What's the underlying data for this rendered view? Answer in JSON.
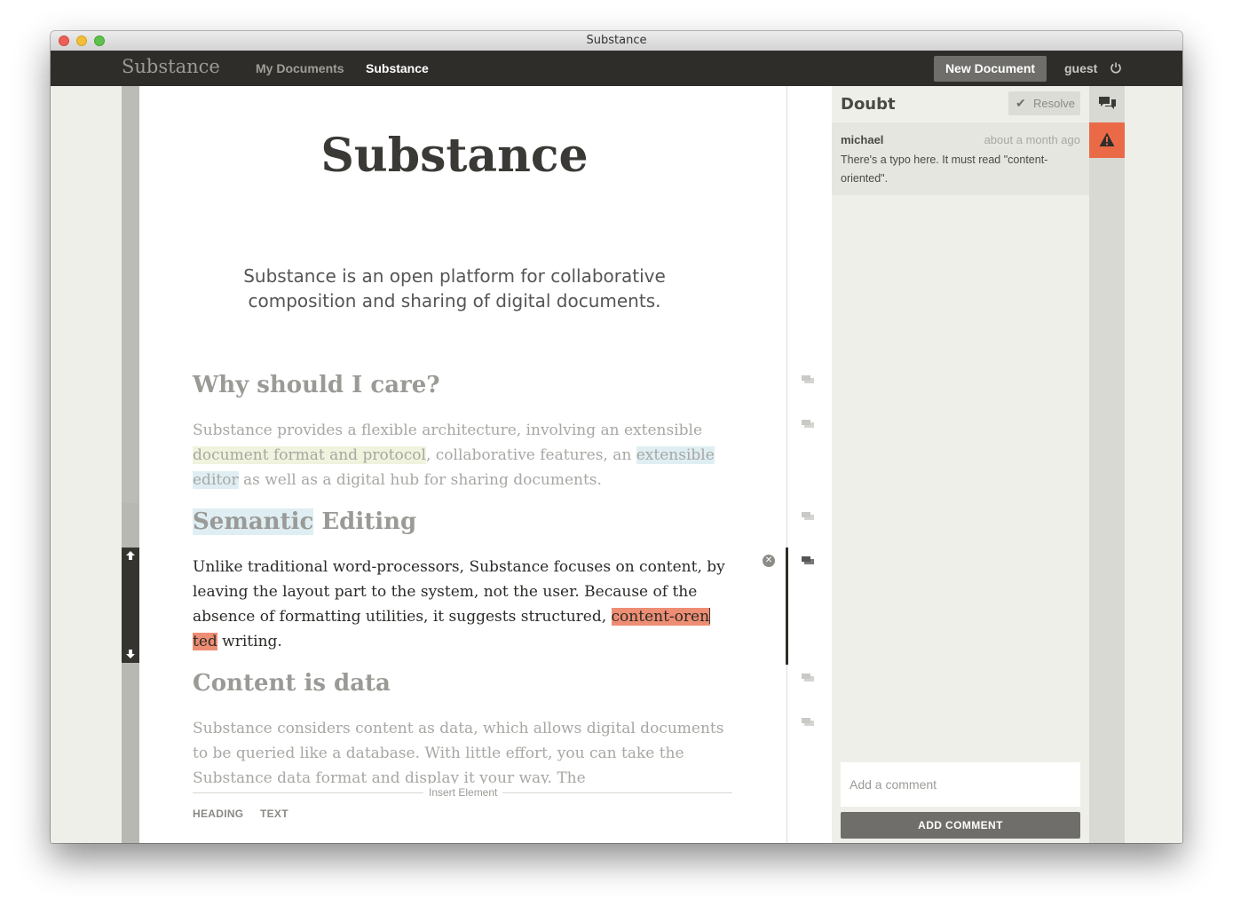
{
  "window": {
    "title": "Substance"
  },
  "navbar": {
    "brand": "Substance",
    "links": [
      {
        "label": "My Documents",
        "active": false
      },
      {
        "label": "Substance",
        "active": true
      }
    ],
    "new_document_label": "New Document",
    "user": "guest"
  },
  "document": {
    "title": "Substance",
    "lead": "Substance is an open platform for collaborative composition and sharing of digital documents.",
    "sections": [
      {
        "heading": "Why should I care?",
        "para_parts": [
          "Substance provides a flexible architecture, involving an extensible ",
          "document format and protocol",
          ", collaborative features, an ",
          "extensible editor",
          " as well as a digital hub for sharing documents."
        ]
      },
      {
        "heading_highlight": "Semantic",
        "heading_rest": " Editing",
        "para_lead": "Unlike traditional word-processors, Substance focuses on content, by leaving the layout part to the system, not the user. Because of the absence of formatting utilities, it suggests structured, ",
        "para_highlight_a": "content-oren",
        "para_highlight_b": "ted",
        "para_tail": " writing."
      },
      {
        "heading": "Content is data",
        "para": "Substance considers content as data, which allows digital documents to be queried like a database. With little effort, you can take the Substance data format and display it your way. The"
      }
    ],
    "insert": {
      "label": "Insert Element",
      "options": [
        "HEADING",
        "TEXT"
      ]
    }
  },
  "panel": {
    "title": "Doubt",
    "resolve_label": "Resolve",
    "comment": {
      "author": "michael",
      "time": "about a month ago",
      "body": "There's a typo here. It must read \"content-oriented\"."
    },
    "add_comment_placeholder": "Add a comment",
    "add_comment_button": "ADD COMMENT"
  },
  "icons": {
    "power": "power-icon",
    "comments": "comments-icon",
    "alert": "warning-icon",
    "comment_marker": "comment-bubble-icon"
  },
  "colors": {
    "navbar": "#2f2d2a",
    "accent_alert": "#ea6a48",
    "highlight_yellow": "#f0f3dd",
    "highlight_blue": "#dfeef3",
    "highlight_red": "#ed8d73"
  }
}
